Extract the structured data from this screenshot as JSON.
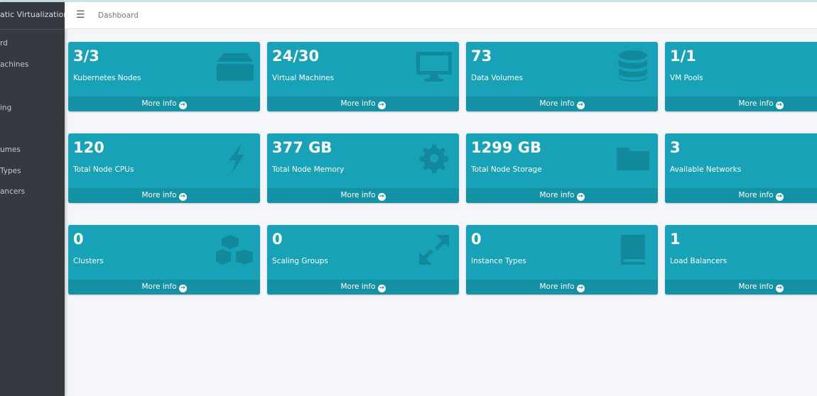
{
  "app": {
    "brand": "atic Virtualization"
  },
  "sidebar": {
    "items": [
      {
        "label": "rd"
      },
      {
        "label": "achines"
      },
      {
        "label": "ing"
      },
      {
        "label": "umes"
      },
      {
        "label": "Types"
      },
      {
        "label": "ancers"
      }
    ]
  },
  "header": {
    "menu_icon": "hamburger-icon",
    "breadcrumb": "Dashboard"
  },
  "colors": {
    "card": "#17a2b8",
    "card_footer": "#1591a5",
    "sidebar": "#343a40"
  },
  "cards": [
    {
      "value": "3/3",
      "label": "Kubernetes Nodes",
      "icon": "server-icon",
      "link": "More info"
    },
    {
      "value": "24/30",
      "label": "Virtual Machines",
      "icon": "desktop-icon",
      "link": "More info"
    },
    {
      "value": "73",
      "label": "Data Volumes",
      "icon": "database-icon",
      "link": "More info"
    },
    {
      "value": "1/1",
      "label": "VM Pools",
      "icon": "pool-icon",
      "link": "More info"
    },
    {
      "value": "120",
      "label": "Total Node CPUs",
      "icon": "bolt-icon",
      "link": "More info"
    },
    {
      "value": "377 GB",
      "label": "Total Node Memory",
      "icon": "gear-icon",
      "link": "More info"
    },
    {
      "value": "1299 GB",
      "label": "Total Node Storage",
      "icon": "folder-icon",
      "link": "More info"
    },
    {
      "value": "3",
      "label": "Available Networks",
      "icon": "network-icon",
      "link": "More info"
    },
    {
      "value": "0",
      "label": "Clusters",
      "icon": "cubes-icon",
      "link": "More info"
    },
    {
      "value": "0",
      "label": "Scaling Groups",
      "icon": "expand-icon",
      "link": "More info"
    },
    {
      "value": "0",
      "label": "Instance Types",
      "icon": "book-icon",
      "link": "More info"
    },
    {
      "value": "1",
      "label": "Load Balancers",
      "icon": "balance-icon",
      "link": "More info"
    }
  ]
}
